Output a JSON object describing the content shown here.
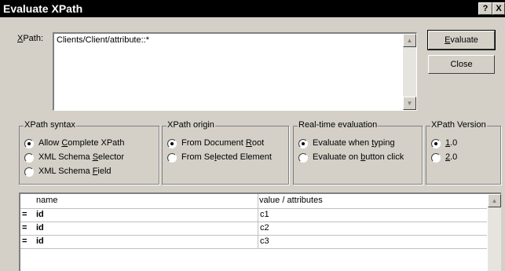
{
  "window": {
    "title": "Evaluate XPath",
    "help": "?",
    "close": "X"
  },
  "xpath": {
    "label": "XPath:",
    "value": "Clients/Client/attribute::*"
  },
  "buttons": {
    "evaluate": "Evaluate",
    "close": "Close"
  },
  "groups": {
    "syntax": {
      "legend": "XPath syntax",
      "options": [
        "Allow Complete XPath",
        "XML Schema Selector",
        "XML Schema Field"
      ],
      "selected": 0
    },
    "origin": {
      "legend": "XPath origin",
      "options": [
        "From Document Root",
        "From Selected Element"
      ],
      "selected": 0
    },
    "realtime": {
      "legend": "Real-time evaluation",
      "options": [
        "Evaluate when typing",
        "Evaluate on button click"
      ],
      "selected": 0
    },
    "version": {
      "legend": "XPath Version",
      "options": [
        "1.0",
        "2.0"
      ],
      "selected": 0
    }
  },
  "results": {
    "columns": [
      "name",
      "value / attributes"
    ],
    "rows": [
      {
        "marker": "=",
        "name": "id",
        "value": "c1"
      },
      {
        "marker": "=",
        "name": "id",
        "value": "c2"
      },
      {
        "marker": "=",
        "name": "id",
        "value": "c3"
      }
    ]
  }
}
